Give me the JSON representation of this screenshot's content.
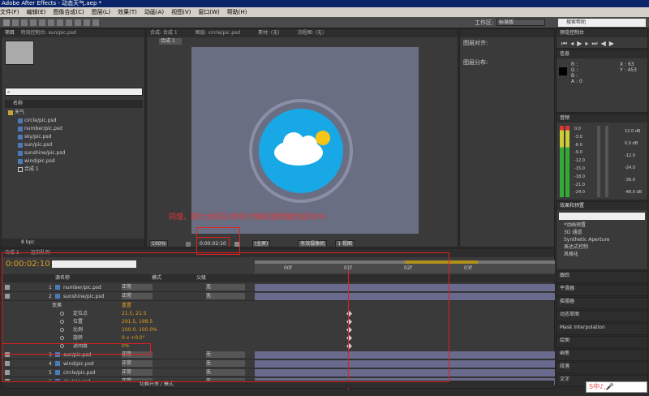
{
  "window": {
    "title": "Adobe After Effects - 动态天气.aep *"
  },
  "menu": [
    "文件(F)",
    "编辑(E)",
    "图像合成(C)",
    "图层(L)",
    "效果(T)",
    "动画(A)",
    "视图(V)",
    "窗口(W)",
    "帮助(H)"
  ],
  "toolbar": {
    "workspace_label": "工作区:",
    "workspace_value": "标准版",
    "search_placeholder": "搜索帮助"
  },
  "project": {
    "tab": "项目",
    "effects_tab": "特效控制台: sun/pic.psd",
    "search_placeholder": "",
    "col_name": "名称",
    "folder": "天气",
    "items": [
      "circle/pic.psd",
      "number/pic.psd",
      "sky/pic.psd",
      "sun/pic.psd",
      "sunshine/pic.psd",
      "wind/pic.psd"
    ],
    "comp": "合成 1",
    "bpc": "8 bpc"
  },
  "viewer": {
    "tabs": [
      "合成: 合成 1",
      "图层: circle/pic.psd",
      "素材: (无)",
      "流程图: (无)"
    ],
    "comp_tag": "合成 1",
    "annotation": "同理，把大太阳在2秒的 时候的透明度改成为0%",
    "zoom": "100%",
    "time": "0:00:02:10",
    "resolution": "(全屏)",
    "camera": "有效摄像机",
    "view": "1 视图"
  },
  "align": {
    "title_align": "图层对齐:",
    "title_dist": "图层分布:"
  },
  "preview": {
    "tab": "预览控制台"
  },
  "info": {
    "tab": "信息",
    "r": "R :",
    "g": "G :",
    "b": "B :",
    "a": "A : 0",
    "x": "X : 63",
    "y": "Y : 453"
  },
  "audio": {
    "tab": "音频",
    "levels": [
      "0.0",
      "-3.0",
      "-6.0",
      "-9.0",
      "-12.0",
      "-15.0",
      "-18.0",
      "-21.0",
      "-24.0"
    ],
    "right_db": [
      "12.0 dB",
      "0.0 dB",
      "-12.0",
      "-24.0",
      "-36.0",
      "-48.0 dB"
    ]
  },
  "effects_panel": {
    "tab": "效果和预置",
    "search_placeholder": "",
    "items": [
      "*动画预置",
      "3D 通道",
      "Synthetic Aperture",
      "表达式控制",
      "风格化"
    ]
  },
  "side_tabs": [
    "跟踪",
    "平滑器",
    "摇摆器",
    "动态草图",
    "Mask Interpolation",
    "绘图",
    "画笔",
    "段落",
    "文字"
  ],
  "timeline": {
    "tabs": [
      "合成 1",
      "渲染队列"
    ],
    "timecode": "0:00:02:10",
    "col_name": "源名称",
    "col_parent": "父级",
    "col_mode": "模式",
    "ticks": [
      "00f",
      "01f",
      "02f",
      "03f"
    ],
    "layers": [
      {
        "num": "1",
        "name": "number/pic.psd",
        "mode": "正常",
        "parent": "无"
      },
      {
        "num": "2",
        "name": "sunshine/pic.psd",
        "mode": "正常",
        "parent": "无"
      }
    ],
    "transform": "变换",
    "reset": "重置",
    "props": [
      {
        "name": "定位点",
        "value": "21.5, 21.5"
      },
      {
        "name": "位置",
        "value": "291.5, 198.5"
      },
      {
        "name": "比例",
        "value": "100.0, 100.0%"
      },
      {
        "name": "旋转",
        "value": "0 x +0.0°"
      },
      {
        "name": "透明度",
        "value": "0%"
      }
    ],
    "layers2": [
      {
        "num": "3",
        "name": "sun/pic.psd",
        "mode": "正常",
        "parent": "无"
      },
      {
        "num": "4",
        "name": "wind/pic.psd",
        "mode": "正常",
        "parent": "无"
      },
      {
        "num": "5",
        "name": "circle/pic.psd",
        "mode": "正常",
        "parent": "无"
      },
      {
        "num": "6",
        "name": "sky/pic.psd",
        "mode": "正常",
        "parent": "无"
      }
    ],
    "footer": "切换开关 / 模式"
  },
  "ime": "S中♪,🎤"
}
